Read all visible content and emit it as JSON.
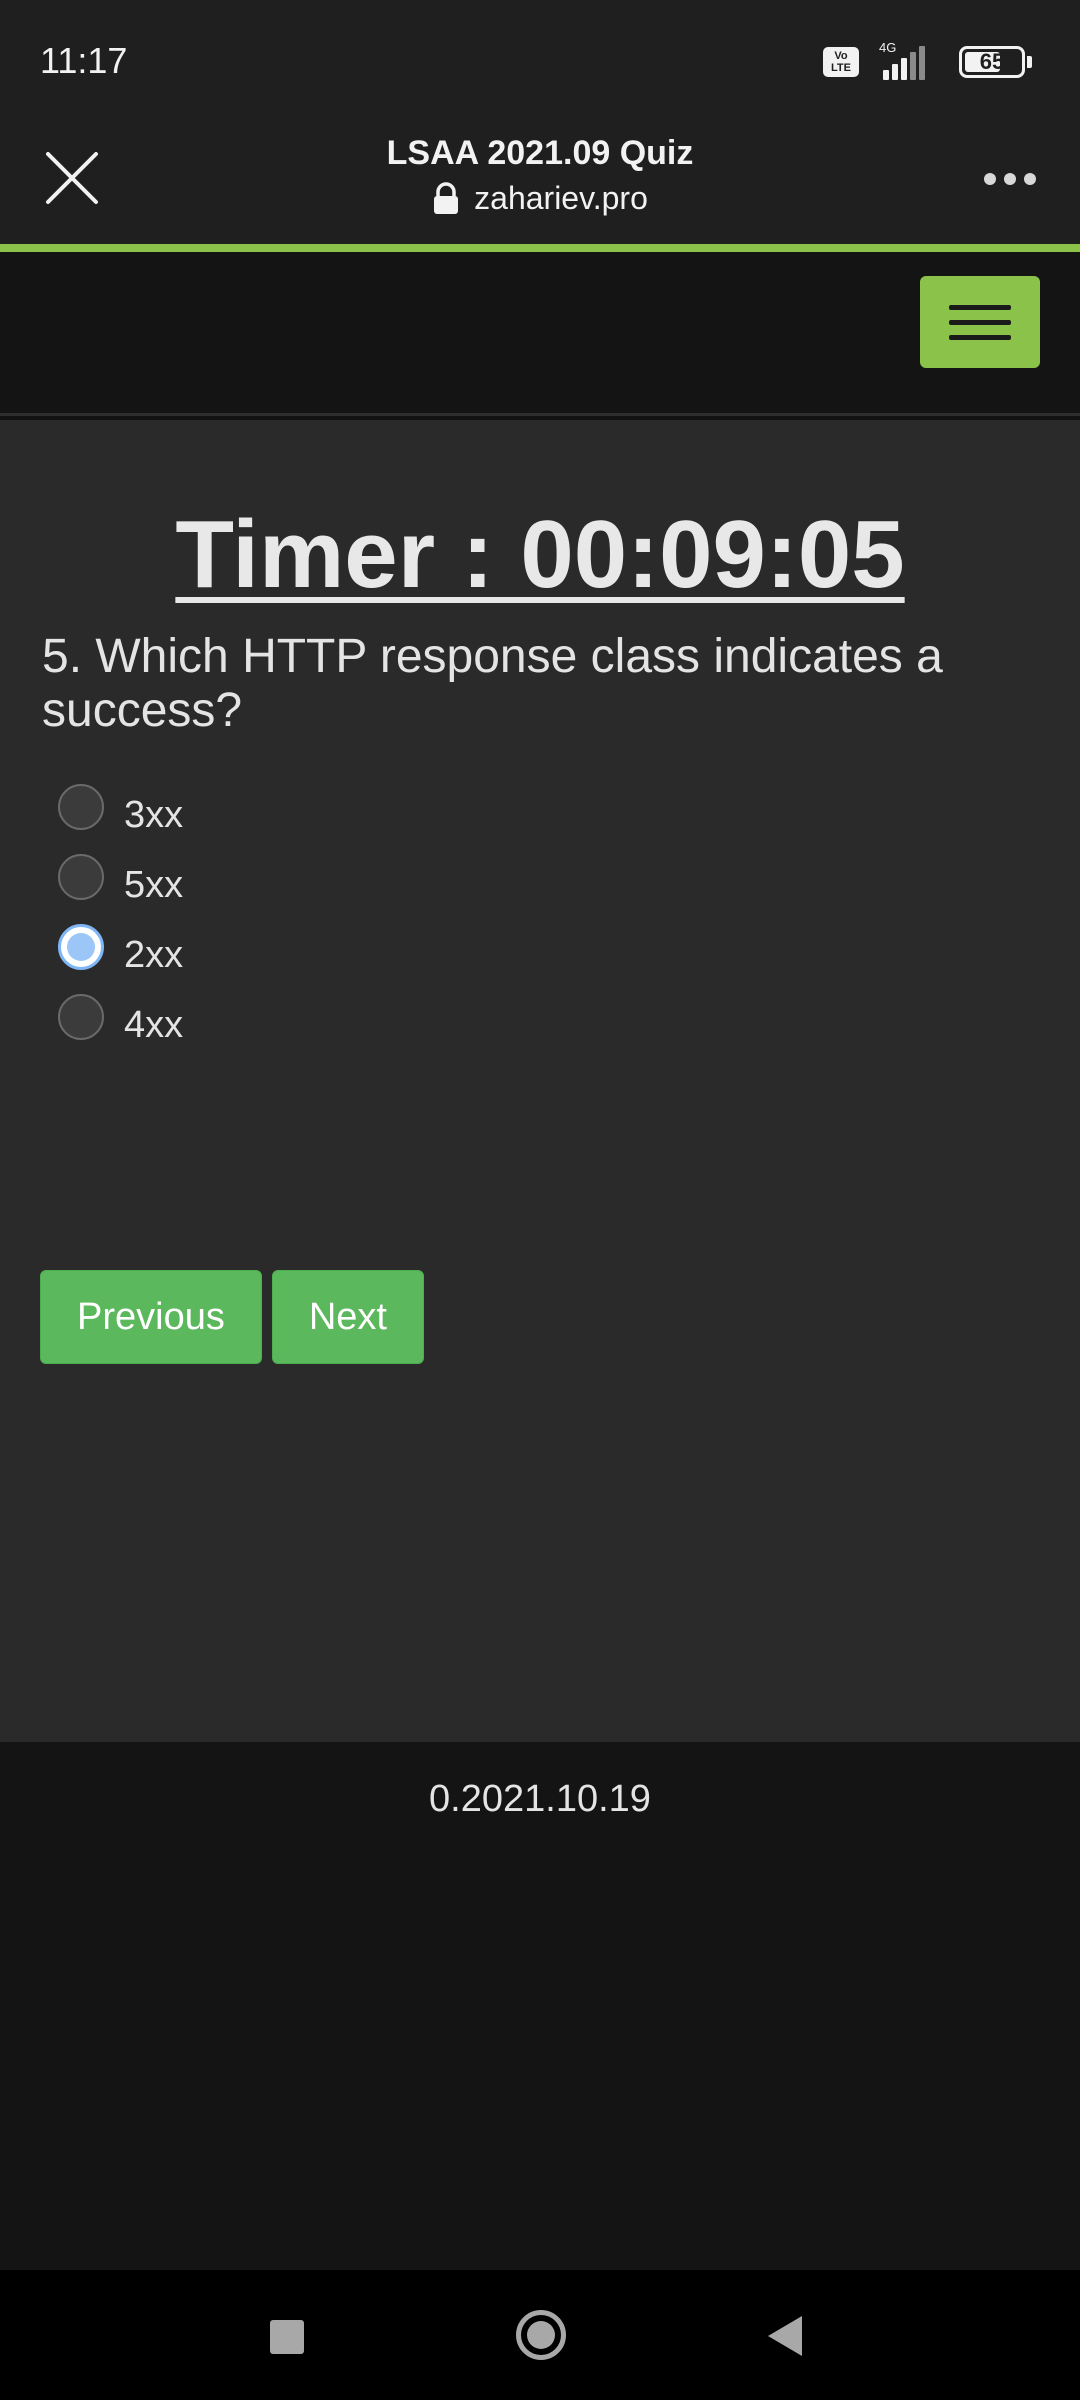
{
  "status_bar": {
    "time": "11:17",
    "volte_label": "Vo\nLTE",
    "network": "4G",
    "battery_level": "65"
  },
  "browser": {
    "title": "LSAA 2021.09 Quiz",
    "domain": "zahariev.pro",
    "close_icon": "close-icon",
    "lock_icon": "lock-icon",
    "more_icon": "more-horizontal-icon",
    "progress_color": "#8bc34a"
  },
  "navbar": {
    "menu_icon": "hamburger-menu-icon",
    "accent": "#8bc34a"
  },
  "quiz": {
    "timer": "Timer : 00:09:05",
    "question": "5. Which HTTP response class indicates a success?",
    "options": [
      {
        "label": "3xx",
        "checked": false
      },
      {
        "label": "5xx",
        "checked": false
      },
      {
        "label": "2xx",
        "checked": true
      },
      {
        "label": "4xx",
        "checked": false
      }
    ],
    "previous_label": "Previous",
    "next_label": "Next",
    "button_color": "#5cb85c"
  },
  "footer": {
    "version": "0.2021.10.19"
  },
  "android_nav": {
    "recents_icon": "recents-square-icon",
    "home_icon": "home-circle-icon",
    "back_icon": "back-triangle-icon"
  }
}
